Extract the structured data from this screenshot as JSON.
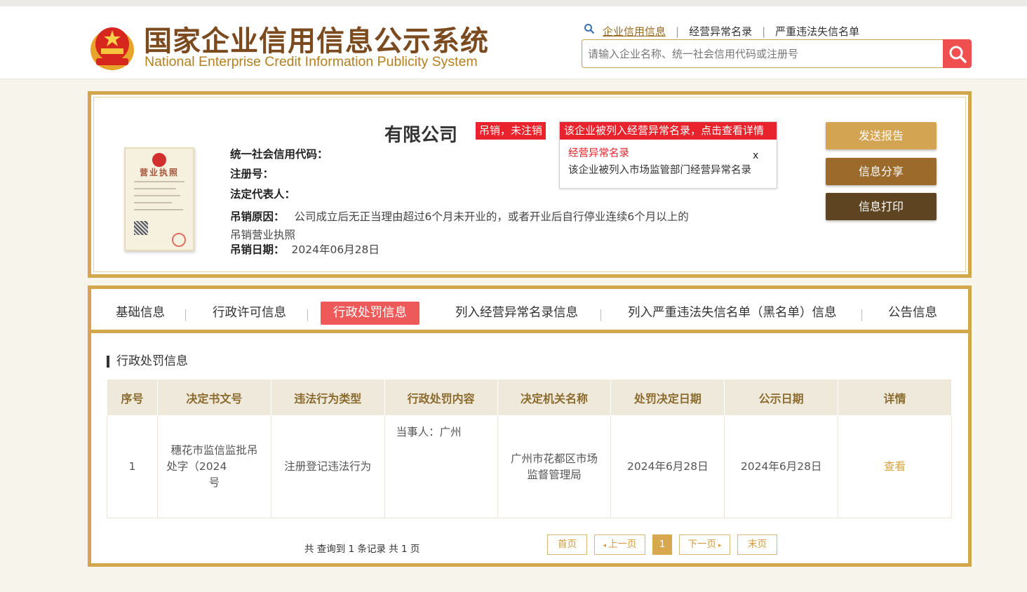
{
  "header": {
    "title_cn": "国家企业信用信息公示系统",
    "title_en": "National Enterprise Credit Information Publicity System",
    "links": [
      "企业信用信息",
      "经营异常名录",
      "严重违法失信名单"
    ],
    "search_placeholder": "请输入企业名称、统一社会信用代码或注册号"
  },
  "company": {
    "name": "有限公司",
    "status": "吊销，未注销",
    "alert_title": "该企业被列入经营异常名录，点击查看详情",
    "alert_sub": "经营异常名录",
    "alert_close": "x",
    "alert_body": "该企业被列入市场监管部门经营异常名录",
    "credit_code_label": "统一社会信用代码：",
    "reg_no_label": "注册号：",
    "legal_rep_label": "法定代表人：",
    "revoke_reason_label": "吊销原因：",
    "revoke_reason": "公司成立后无正当理由超过6个月未开业的，或者开业后自行停业连续6个月以上的吊销营业执照",
    "revoke_date_label": "吊销日期：",
    "revoke_date": "2024年06月28日",
    "license_title": "营业执照"
  },
  "actions": {
    "send_report": "发送报告",
    "share": "信息分享",
    "print": "信息打印"
  },
  "tabs": [
    "基础信息",
    "行政许可信息",
    "行政处罚信息",
    "列入经营异常名录信息",
    "列入严重违法失信名单（黑名单）信息",
    "公告信息"
  ],
  "section": {
    "title": "行政处罚信息"
  },
  "table": {
    "headers": [
      "序号",
      "决定书文号",
      "违法行为类型",
      "行政处罚内容",
      "决定机关名称",
      "处罚决定日期",
      "公示日期",
      "详情"
    ],
    "rows": [
      {
        "no": "1",
        "doc_line1": "穗花市监信监批吊",
        "doc_line2": "处字（2024",
        "doc_line3": "号",
        "violation": "注册登记违法行为",
        "content": "当事人：广州",
        "authority": "广州市花都区市场监督管理局",
        "decision_date": "2024年6月28日",
        "publish_date": "2024年6月28日",
        "detail": "查看"
      }
    ]
  },
  "pagination": {
    "summary": "共 查询到 1 条记录 共 1 页",
    "first": "首页",
    "prev": "上一页",
    "current": "1",
    "next": "下一页",
    "last": "末页"
  },
  "colors": {
    "gold": "#d2a64b",
    "red": "#e8232c",
    "brown": "#7b4a1e"
  }
}
